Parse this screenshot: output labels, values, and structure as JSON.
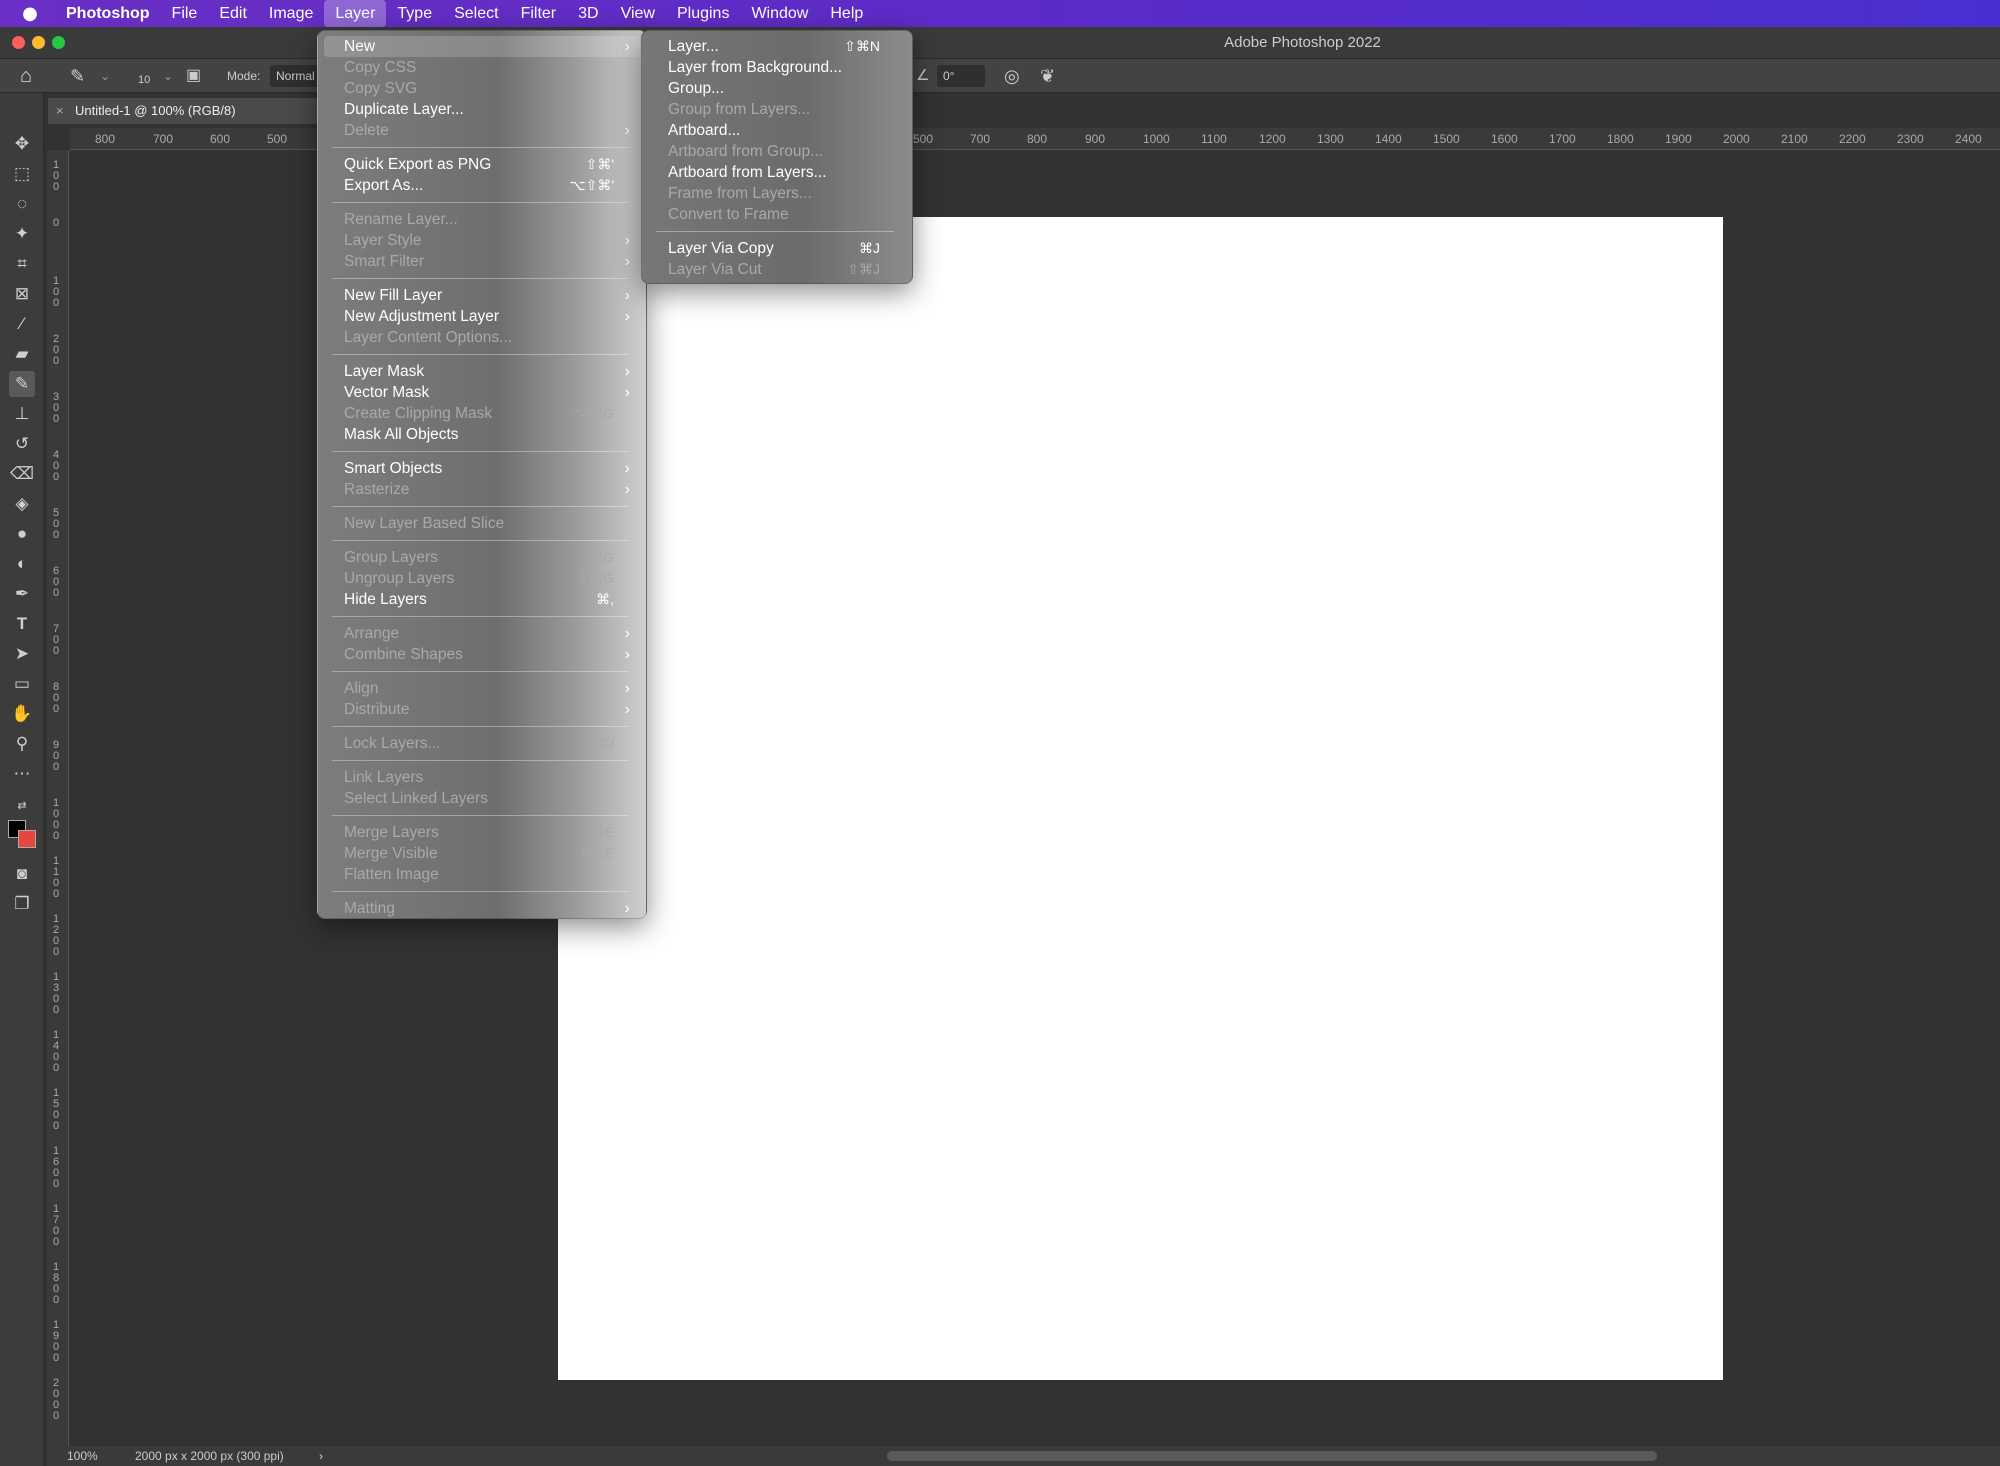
{
  "menubar": {
    "apple_icon": "apple-logo-icon",
    "app": "Photoshop",
    "items": [
      "File",
      "Edit",
      "Image",
      "Layer",
      "Type",
      "Select",
      "Filter",
      "3D",
      "View",
      "Plugins",
      "Window",
      "Help"
    ]
  },
  "window": {
    "title": "Adobe Photoshop 2022"
  },
  "options": {
    "brush_size": "10",
    "mode_label": "Mode:",
    "mode_value": "Normal",
    "angle": "0°"
  },
  "document": {
    "tab_title": "Untitled-1 @ 100% (RGB/8)",
    "close": "×"
  },
  "ruler": {
    "top_ticks": [
      "800",
      "700",
      "600",
      "500",
      "500",
      "700",
      "800",
      "900",
      "1000",
      "1100",
      "1200",
      "1300",
      "1400",
      "1500",
      "1600",
      "1700",
      "1800",
      "1900",
      "2000",
      "2100",
      "2200",
      "2300",
      "2400"
    ],
    "left_ticks": [
      "100",
      "0",
      "100",
      "200",
      "300",
      "400",
      "500",
      "600",
      "700",
      "800",
      "900",
      "1000",
      "1100",
      "1200",
      "1300",
      "1400",
      "1500",
      "1600",
      "1700",
      "1800",
      "1900",
      "2000"
    ]
  },
  "status": {
    "zoom": "100%",
    "doc_info": "2000 px x 2000 px (300 ppi)",
    "more": "›"
  },
  "layer_menu": {
    "items": [
      {
        "label": "New",
        "submenu": true,
        "highlight": true
      },
      {
        "label": "Copy CSS",
        "disabled": true
      },
      {
        "label": "Copy SVG",
        "disabled": true
      },
      {
        "label": "Duplicate Layer..."
      },
      {
        "label": "Delete",
        "disabled": true,
        "submenu": true
      },
      {
        "sep": true
      },
      {
        "label": "Quick Export as PNG",
        "shortcut": "⇧⌘'"
      },
      {
        "label": "Export As...",
        "shortcut": "⌥⇧⌘'"
      },
      {
        "sep": true
      },
      {
        "label": "Rename Layer...",
        "disabled": true
      },
      {
        "label": "Layer Style",
        "disabled": true,
        "submenu": true
      },
      {
        "label": "Smart Filter",
        "disabled": true,
        "submenu": true
      },
      {
        "sep": true
      },
      {
        "label": "New Fill Layer",
        "submenu": true
      },
      {
        "label": "New Adjustment Layer",
        "submenu": true
      },
      {
        "label": "Layer Content Options...",
        "disabled": true
      },
      {
        "sep": true
      },
      {
        "label": "Layer Mask",
        "submenu": true
      },
      {
        "label": "Vector Mask",
        "submenu": true
      },
      {
        "label": "Create Clipping Mask",
        "disabled": true,
        "shortcut": "⌥⌘G"
      },
      {
        "label": "Mask All Objects"
      },
      {
        "sep": true
      },
      {
        "label": "Smart Objects",
        "submenu": true
      },
      {
        "label": "Rasterize",
        "disabled": true,
        "submenu": true
      },
      {
        "sep": true
      },
      {
        "label": "New Layer Based Slice",
        "disabled": true
      },
      {
        "sep": true
      },
      {
        "label": "Group Layers",
        "disabled": true,
        "shortcut": "⌘G"
      },
      {
        "label": "Ungroup Layers",
        "disabled": true,
        "shortcut": "⇧⌘G"
      },
      {
        "label": "Hide Layers",
        "shortcut": "⌘,"
      },
      {
        "sep": true
      },
      {
        "label": "Arrange",
        "disabled": true,
        "submenu": true
      },
      {
        "label": "Combine Shapes",
        "disabled": true,
        "submenu": true
      },
      {
        "sep": true
      },
      {
        "label": "Align",
        "disabled": true,
        "submenu": true
      },
      {
        "label": "Distribute",
        "disabled": true,
        "submenu": true
      },
      {
        "sep": true
      },
      {
        "label": "Lock Layers...",
        "disabled": true,
        "shortcut": "⌘/"
      },
      {
        "sep": true
      },
      {
        "label": "Link Layers",
        "disabled": true
      },
      {
        "label": "Select Linked Layers",
        "disabled": true
      },
      {
        "sep": true
      },
      {
        "label": "Merge Layers",
        "disabled": true,
        "shortcut": "⌘E"
      },
      {
        "label": "Merge Visible",
        "disabled": true,
        "shortcut": "⇧⌘E"
      },
      {
        "label": "Flatten Image",
        "disabled": true
      },
      {
        "sep": true
      },
      {
        "label": "Matting",
        "disabled": true,
        "submenu": true
      }
    ]
  },
  "new_submenu": {
    "items": [
      {
        "label": "Layer...",
        "shortcut": "⇧⌘N"
      },
      {
        "label": "Layer from Background..."
      },
      {
        "label": "Group..."
      },
      {
        "label": "Group from Layers...",
        "disabled": true
      },
      {
        "label": "Artboard..."
      },
      {
        "label": "Artboard from Group...",
        "disabled": true
      },
      {
        "label": "Artboard from Layers..."
      },
      {
        "label": "Frame from Layers...",
        "disabled": true
      },
      {
        "label": "Convert to Frame",
        "disabled": true
      },
      {
        "sep": true
      },
      {
        "label": "Layer Via Copy",
        "shortcut": "⌘J"
      },
      {
        "label": "Layer Via Cut",
        "disabled": true,
        "shortcut": "⇧⌘J"
      }
    ]
  },
  "colors": {
    "menubar_accent": "#5c2bc8",
    "foreground_swatch": "#000000",
    "background_swatch": "#e8453c"
  }
}
